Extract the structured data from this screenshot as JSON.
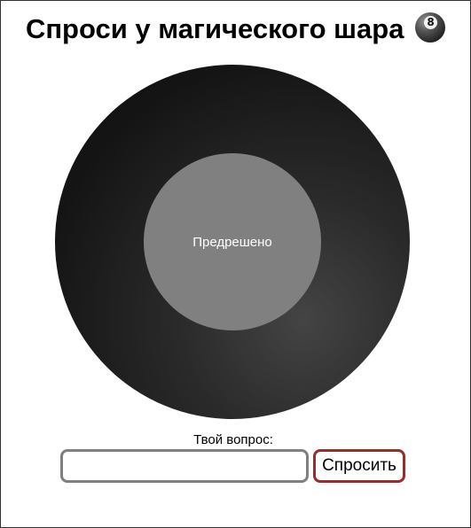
{
  "header": {
    "title": "Спроси у магического шара",
    "emoji_icon": "8-ball-icon"
  },
  "ball": {
    "answer": "Предрешено"
  },
  "form": {
    "label": "Твой вопрос:",
    "input_value": "",
    "button_label": "Спросить"
  },
  "colors": {
    "ball": "#141414",
    "answer_window": "#808080",
    "input_border": "#808080",
    "button_border": "#9b2c2c"
  }
}
